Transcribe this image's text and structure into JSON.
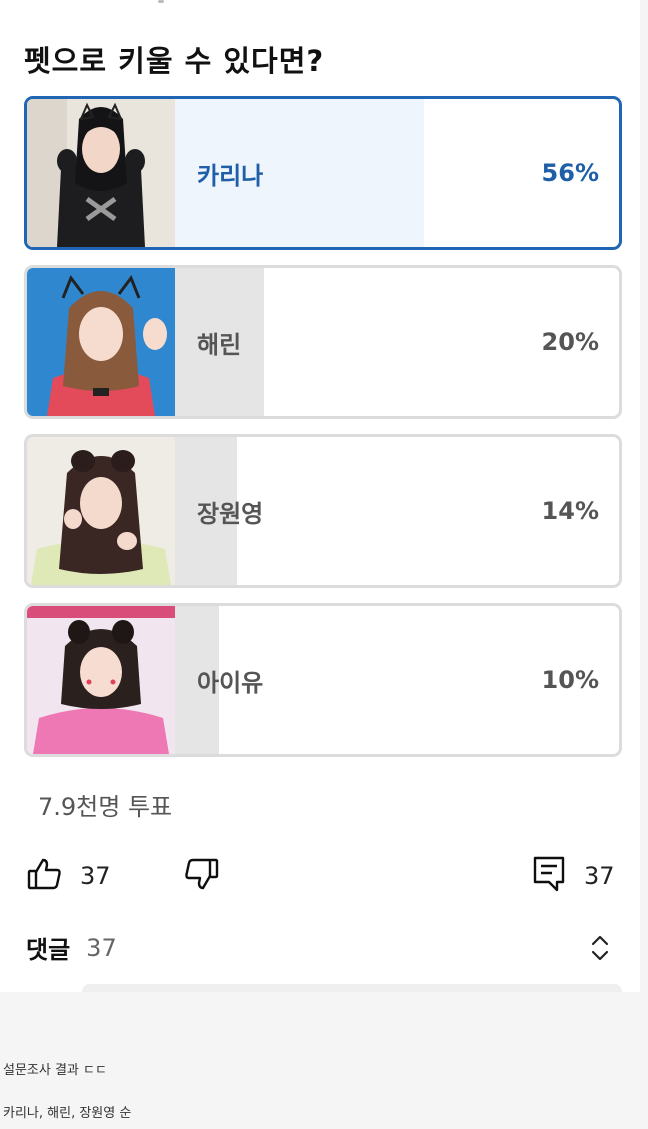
{
  "poll": {
    "title": "펫으로 키울 수 있다면?",
    "options": [
      {
        "name": "카리나",
        "percent_label": "56%",
        "percent": 56,
        "selected": true
      },
      {
        "name": "해린",
        "percent_label": "20%",
        "percent": 20,
        "selected": false
      },
      {
        "name": "장원영",
        "percent_label": "14%",
        "percent": 14,
        "selected": false
      },
      {
        "name": "아이유",
        "percent_label": "10%",
        "percent": 10,
        "selected": false
      }
    ],
    "votes": "7.9천명 투표"
  },
  "actions": {
    "like_count": "37",
    "comment_count": "37"
  },
  "comments": {
    "label": "댓글",
    "count": "37"
  },
  "captions": {
    "line1": "설문조사 결과 ㄷㄷ",
    "line2": "카리나, 해린, 장원영 순"
  },
  "colors": {
    "accent": "#2166b4",
    "selected_fill": "#eef5fc",
    "other_fill": "#e5e5e5"
  },
  "icons": [
    "thumbs-up-icon",
    "thumbs-down-icon",
    "comment-icon",
    "expand-collapse-icon"
  ]
}
